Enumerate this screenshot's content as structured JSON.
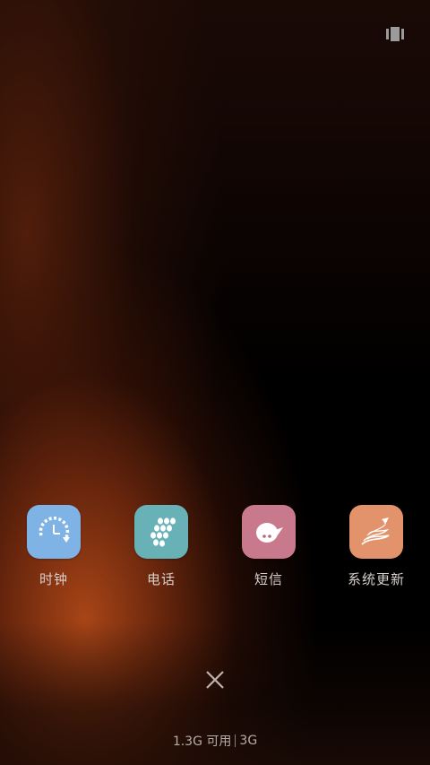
{
  "header": {
    "multiwindow_icon": "multiwindow-icon"
  },
  "apps": [
    {
      "label": "时钟",
      "icon": "clock-icon",
      "color": "#7fb3e6"
    },
    {
      "label": "电话",
      "icon": "phone-dialpad-icon",
      "color": "#67b1b7"
    },
    {
      "label": "短信",
      "icon": "message-bubble-icon",
      "color": "#c9798c"
    },
    {
      "label": "系统更新",
      "icon": "system-update-icon",
      "color": "#e3936c"
    }
  ],
  "controls": {
    "close_icon": "close-icon"
  },
  "memory": {
    "available": "1.3G 可用",
    "total": "3G"
  }
}
